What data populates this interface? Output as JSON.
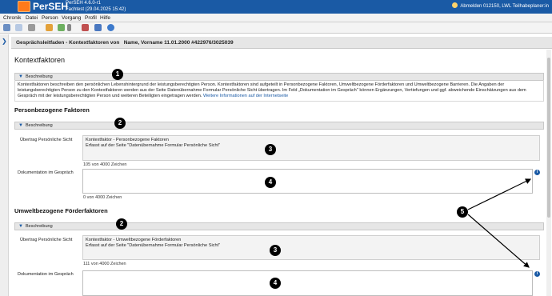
{
  "app": {
    "name": "PerSEH",
    "version": "PerSEH 4.6.0-r1",
    "build": "Fachtest (29.04.2025 15:42)",
    "user": "Abmelden 012150, LWL Teilhabeplaner:in"
  },
  "menu": [
    "Chronik",
    "Datei",
    "Person",
    "Vorgang",
    "Profil",
    "Hilfe"
  ],
  "header": {
    "title": "Gesprächsleitfaden - Kontextfaktoren von   Name, Vorname 11.01.2000 #422976/3025039"
  },
  "page": {
    "title": "Kontextfaktoren",
    "beschreibung_label": "Beschreibung",
    "description": "Kontextfaktoren beschreiben den persönlichen Lebenshintergrund der leistungsberechtigten Person. Kontextfaktoren sind aufgeteilt in Personbezogene Faktoren, Umweltbezogene Förderfaktoren und Umweltbezogene Barrieren. Die Angaben der leistungsberechtigten Person zu den Kontextfaktoren werden aus der Seite Datenübernahme Formular Persönliche Sicht übertragen. Im Feld „Dokumentation im Gespräch\" können Ergänzungen, Vertiefungen und ggf. abweichende Einschätzungen aus dem Gespräch mit der leistungsberechtigten Person und weiteren Beteiligten eingetragen werden.",
    "description_link": "Weitere Informationen auf der Internetseite"
  },
  "sections": [
    {
      "title": "Personbezogene Faktoren",
      "beschreibung_label": "Beschreibung",
      "uebertrag_label": "Übertrag Persönliche Sicht",
      "uebertrag_line1": "Kontextfaktor - Personbezogene Faktoren",
      "uebertrag_line2": "Erfasst auf der Seite \"Datenübernahme Formular Persönliche Sicht\"",
      "uebertrag_count": "105 von 4000 Zeichen",
      "doku_label": "Dokumentation im Gespräch",
      "doku_count": "0 von 4000 Zeichen"
    },
    {
      "title": "Umweltbezogene Förderfaktoren",
      "beschreibung_label": "Beschreibung",
      "uebertrag_label": "Übertrag Persönliche Sicht",
      "uebertrag_line1": "Kontextfaktor - Umweltbezogene Förderfaktoren",
      "uebertrag_line2": "Erfasst auf der Seite \"Datenübernahme Formular Persönliche Sicht\"",
      "uebertrag_count": "111 von 4000 Zeichen",
      "doku_label": "Dokumentation im Gespräch"
    }
  ],
  "markers": [
    "1",
    "2",
    "3",
    "4",
    "2",
    "3",
    "4",
    "5"
  ],
  "icons": {
    "toolbar": [
      "save-icon",
      "copy-icon",
      "print-icon",
      "person-icon",
      "add-icon",
      "settings-icon",
      "badge-icon",
      "help-icon"
    ],
    "info": "info-icon",
    "chevron": "chevron-down-icon"
  },
  "colors": {
    "brand": "#1a5aa5",
    "logo": "#ff7a1a",
    "marker": "#000000"
  }
}
